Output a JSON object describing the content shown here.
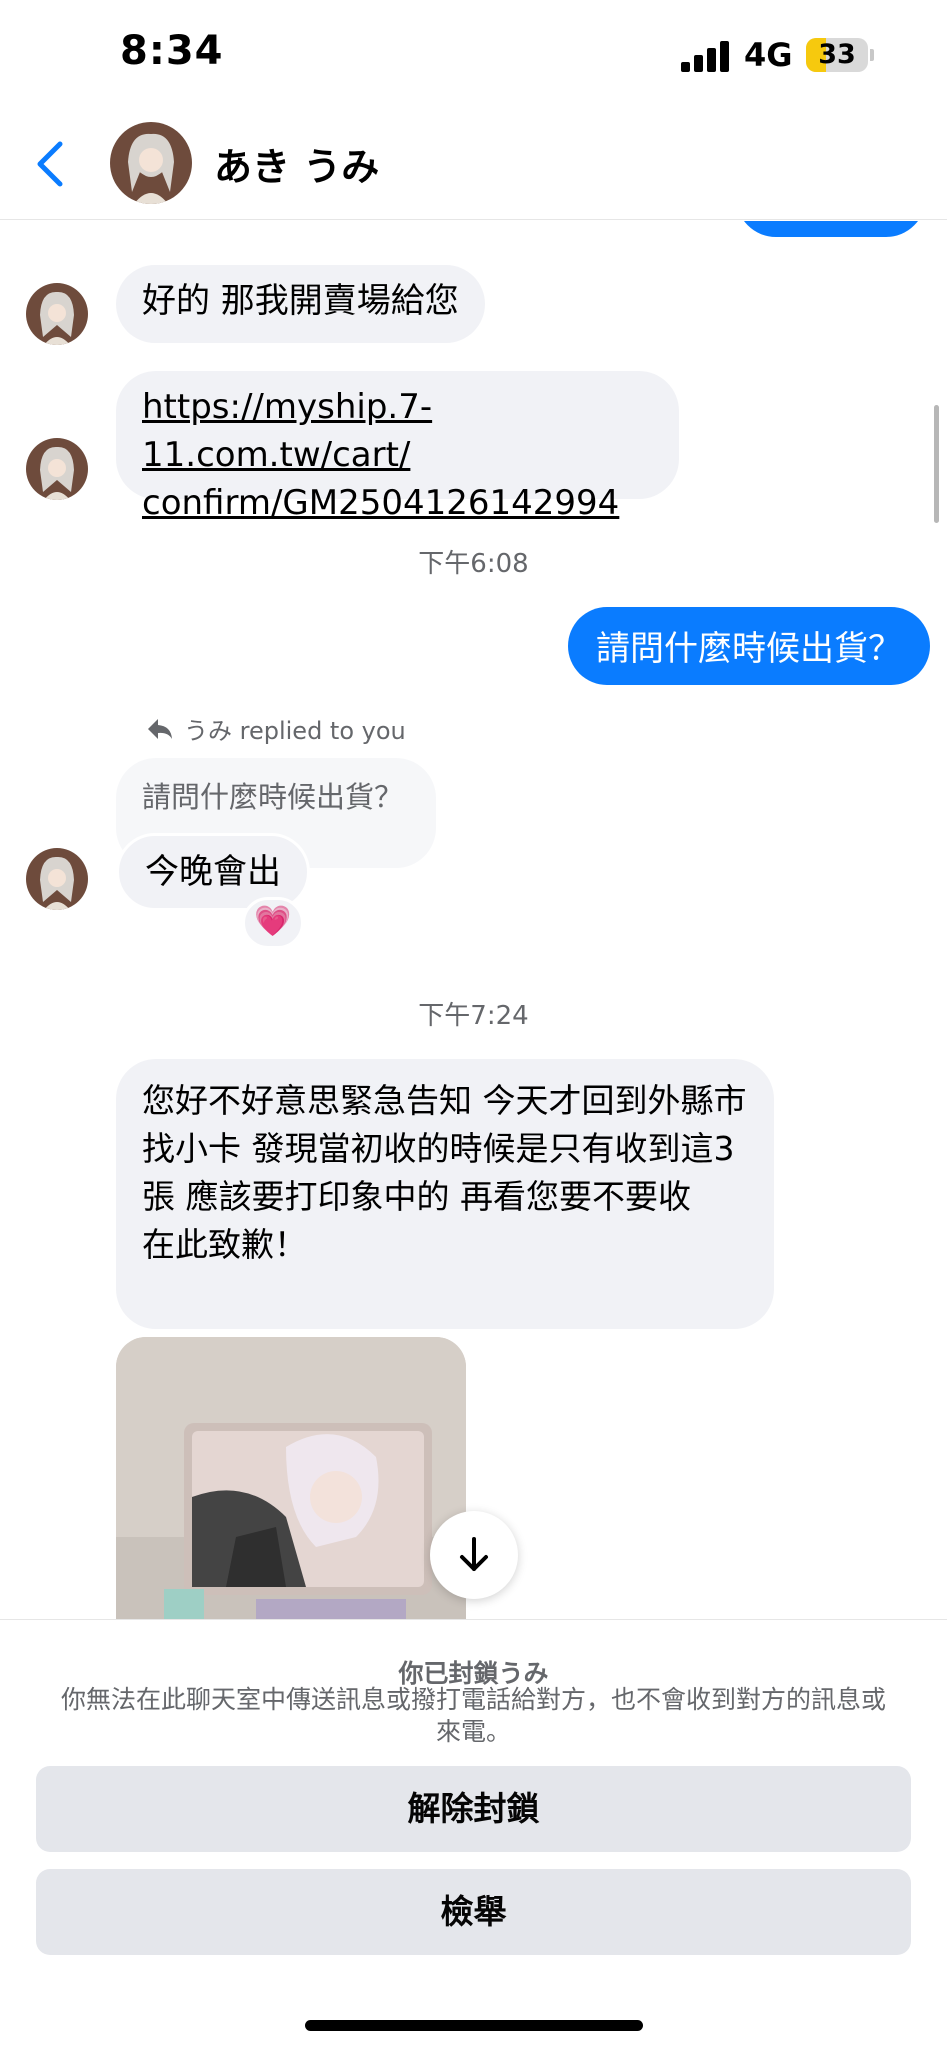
{
  "status_bar": {
    "time": "8:34",
    "network": "4G",
    "battery_level": "33",
    "battery_fraction": 0.33
  },
  "header": {
    "contact_name": "あき うみ",
    "back_icon": "chevron-left-icon",
    "avatar_icon": "contact-avatar"
  },
  "messages": {
    "m1": "好的 那我開賣場給您",
    "m2_link_line1": "https://myship.7-11.com.tw/cart/",
    "m2_link_line2": "confirm/GM2504126142994",
    "ts1": "下午6:08",
    "sent": "請問什麼時候出貨？",
    "reply_tag": "うみ replied to you",
    "quoted": "請問什麼時候出貨？",
    "reply": "今晚會出",
    "reaction_emoji": "💗",
    "ts2": "下午7:24",
    "long_message": "您好不好意思緊急告知 今天才回到外縣市找小卡 發現當初收的時候是只有收到這3張 應該要打印象中的 再看您要不要收\n在此致歉！"
  },
  "bottom_panel": {
    "title": "你已封鎖うみ",
    "description": "你無法在此聊天室中傳送訊息或撥打電話給對方，也不會收到對方的訊息或來電。",
    "unblock_label": "解除封鎖",
    "report_label": "檢舉"
  },
  "colors": {
    "outgoing_bubble": "#0a7cff",
    "incoming_bubble": "#f1f2f6",
    "accent_link": "#0a7cff"
  }
}
